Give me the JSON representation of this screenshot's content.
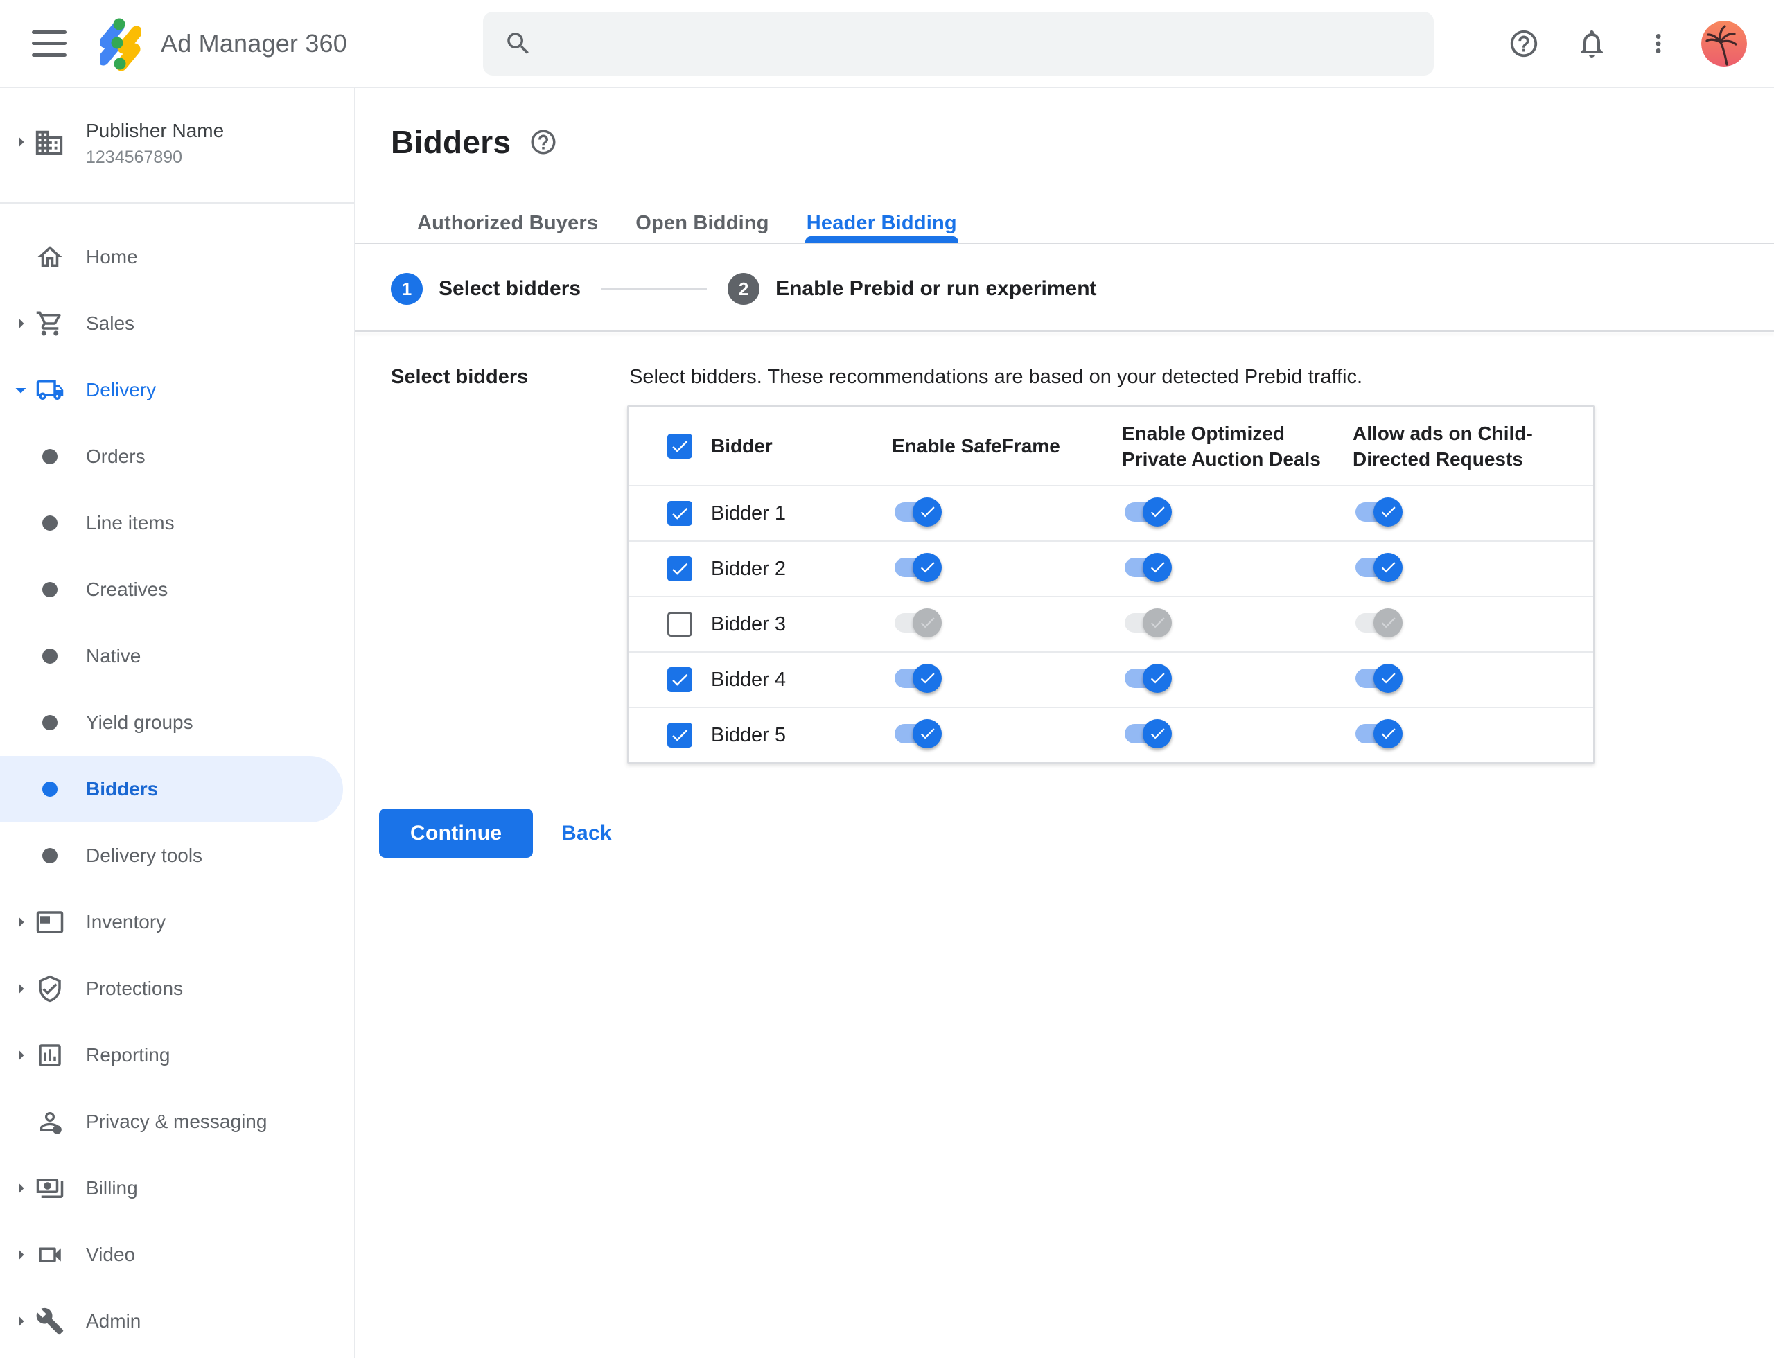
{
  "topbar": {
    "app_name": "Ad Manager 360",
    "search_placeholder": "",
    "search_value": ""
  },
  "sidebar": {
    "publisher": {
      "name": "Publisher Name",
      "id": "1234567890"
    },
    "items": [
      {
        "label": "Home",
        "icon": "home-icon",
        "caret": false
      },
      {
        "label": "Sales",
        "icon": "cart-icon",
        "caret": true
      },
      {
        "label": "Delivery",
        "icon": "truck-icon",
        "caret": "down",
        "expanded": true
      },
      {
        "label": "Orders",
        "bullet": true
      },
      {
        "label": "Line items",
        "bullet": true
      },
      {
        "label": "Creatives",
        "bullet": true
      },
      {
        "label": "Native",
        "bullet": true
      },
      {
        "label": "Yield groups",
        "bullet": true
      },
      {
        "label": "Bidders",
        "bullet": true,
        "selected": true
      },
      {
        "label": "Delivery tools",
        "bullet": true
      },
      {
        "label": "Inventory",
        "icon": "ad-unit-icon",
        "caret": true
      },
      {
        "label": "Protections",
        "icon": "shield-check-icon",
        "caret": true
      },
      {
        "label": "Reporting",
        "icon": "bar-chart-icon",
        "caret": true
      },
      {
        "label": "Privacy & messaging",
        "icon": "person-badge-icon",
        "caret": false
      },
      {
        "label": "Billing",
        "icon": "payments-icon",
        "caret": true
      },
      {
        "label": "Video",
        "icon": "videocam-icon",
        "caret": true
      },
      {
        "label": "Admin",
        "icon": "wrench-icon",
        "caret": true
      }
    ]
  },
  "page": {
    "title": "Bidders",
    "tabs": [
      {
        "label": "Authorized Buyers",
        "active": false
      },
      {
        "label": "Open Bidding",
        "active": false
      },
      {
        "label": "Header Bidding",
        "active": true
      }
    ],
    "steps": [
      {
        "number": "1",
        "label": "Select bidders",
        "active": true
      },
      {
        "number": "2",
        "label": "Enable Prebid or run experiment",
        "active": false
      }
    ],
    "section_label": "Select bidders",
    "description": "Select bidders. These recommendations are based on your detected Prebid traffic.",
    "table": {
      "header_checked": true,
      "columns": [
        "Bidder",
        "Enable SafeFrame",
        "Enable Optimized Private Auction Deals",
        "Allow ads on Child-Directed Requests"
      ],
      "rows": [
        {
          "name": "Bidder 1",
          "selected": true,
          "safeframe": true,
          "optimized_deals": true,
          "child_directed": true
        },
        {
          "name": "Bidder 2",
          "selected": true,
          "safeframe": true,
          "optimized_deals": true,
          "child_directed": true
        },
        {
          "name": "Bidder 3",
          "selected": false,
          "safeframe": false,
          "optimized_deals": false,
          "child_directed": false
        },
        {
          "name": "Bidder 4",
          "selected": true,
          "safeframe": true,
          "optimized_deals": true,
          "child_directed": true
        },
        {
          "name": "Bidder 5",
          "selected": true,
          "safeframe": true,
          "optimized_deals": true,
          "child_directed": true
        }
      ]
    },
    "actions": {
      "continue": "Continue",
      "back": "Back"
    }
  },
  "colors": {
    "accent": "#1a73e8",
    "accent_dark": "#1967d2",
    "selected_bg": "#e8f0fe",
    "toggle_track_on": "#93b9f4",
    "toggle_track_off": "#e8eaec",
    "toggle_thumb_off": "#b3b6b9",
    "logo_blue": "#4285f4",
    "logo_yellow": "#fbbc04",
    "logo_green": "#34a853"
  }
}
